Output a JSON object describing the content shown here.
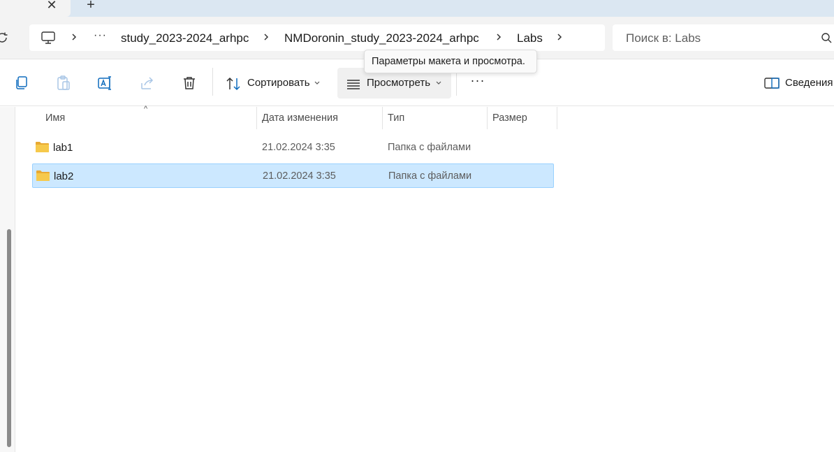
{
  "tabs": {
    "close_symbol": "✕",
    "add_symbol": "+"
  },
  "address": {
    "crumbs": [
      "study_2023-2024_arhpc",
      "NMDoronin_study_2023-2024_arhpc",
      "Labs"
    ],
    "overflow": "···"
  },
  "search": {
    "placeholder": "Поиск в: Labs"
  },
  "toolbar": {
    "sort_label": "Сортировать",
    "view_label": "Просмотреть",
    "more_label": "···",
    "details_label": "Сведения"
  },
  "tooltip": {
    "text": "Параметры макета и просмотра."
  },
  "columns": {
    "name": "Имя",
    "date": "Дата изменения",
    "type": "Тип",
    "size": "Размер"
  },
  "files": [
    {
      "name": "lab1",
      "date": "21.02.2024 3:35",
      "type": "Папка с файлами",
      "selected": false
    },
    {
      "name": "lab2",
      "date": "21.02.2024 3:35",
      "type": "Папка с файлами",
      "selected": true
    }
  ],
  "colors": {
    "selection_bg": "#cce8ff",
    "selection_border": "#99d1ff",
    "tabstrip_bg": "#dbe7f2",
    "folder_yellow": "#f4c542"
  },
  "icons": [
    "close-icon",
    "add-tab-icon",
    "refresh-icon",
    "computer-icon",
    "chevron-right-icon",
    "search-icon",
    "copy-icon",
    "paste-icon",
    "rename-icon",
    "share-icon",
    "delete-icon",
    "sort-icon",
    "view-icon",
    "details-pane-icon",
    "folder-icon"
  ]
}
